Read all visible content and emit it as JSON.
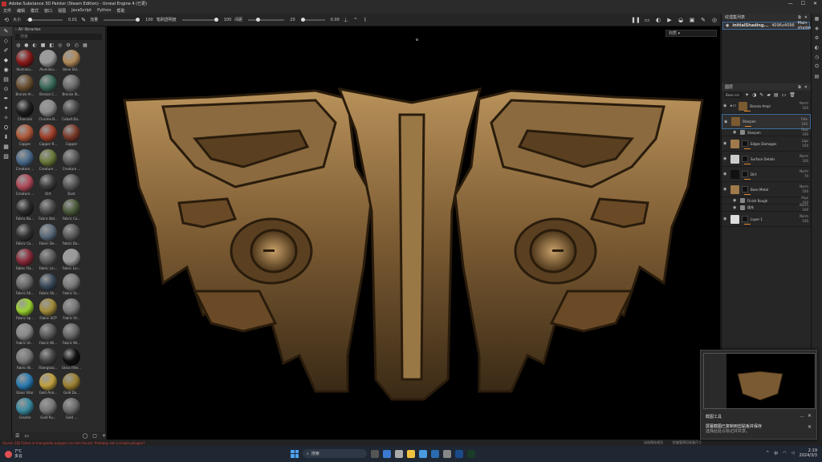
{
  "window": {
    "title": "Adobe Substance 3D Painter (Steam Edition) - Unreal Engine 4 (已更)",
    "controls": [
      "—",
      "☐",
      "✕"
    ]
  },
  "menu": [
    "文件",
    "编辑",
    "模式",
    "窗口",
    "视图",
    "JavaScript",
    "Python",
    "帮助"
  ],
  "toolbar": {
    "size_label": "大小",
    "size_value": "0.01",
    "flow_label": "流量",
    "flow_value": "100",
    "opacity_label": "笔刷透明度",
    "opacity_value": "100",
    "spacing_label": "间距",
    "spacing_value": "20",
    "extra_value": "0.00"
  },
  "shelf": {
    "header": "All libraries",
    "search_placeholder": "搜索",
    "materials": [
      {
        "name": "Aluminiu...",
        "color": "#8a1a1a"
      },
      {
        "name": "Aluminiu...",
        "color": "#9a9a9a"
      },
      {
        "name": "Bone Stil...",
        "color": "#b08a58"
      },
      {
        "name": "Bronze Ar...",
        "color": "#6a5030"
      },
      {
        "name": "Bronze C...",
        "color": "#3a6a5a"
      },
      {
        "name": "Bronze St...",
        "color": "#6a6a6a"
      },
      {
        "name": "Charcoal",
        "color": "#1e1e1e"
      },
      {
        "name": "Chrome B...",
        "color": "#8a8a8a"
      },
      {
        "name": "Cobalt Da...",
        "color": "#4a4a4a"
      },
      {
        "name": "Copper",
        "color": "#b05a3a"
      },
      {
        "name": "Copper R...",
        "color": "#a0402a"
      },
      {
        "name": "Copper",
        "color": "#7a3a2a"
      },
      {
        "name": "Creature ...",
        "color": "#4a6a8a"
      },
      {
        "name": "Creature ...",
        "color": "#6a7a3a"
      },
      {
        "name": "Creature ...",
        "color": "#5a5a5a"
      },
      {
        "name": "Creature ...",
        "color": "#b04a5a"
      },
      {
        "name": "Dirt",
        "color": "#3a3a3a"
      },
      {
        "name": "Dust",
        "color": "#555"
      },
      {
        "name": "Fabric Ba...",
        "color": "#2a2a2a"
      },
      {
        "name": "Fabric Bot...",
        "color": "#4a4a4a"
      },
      {
        "name": "Fabric Co...",
        "color": "#4a5a3a"
      },
      {
        "name": "Fabric Co...",
        "color": "#333"
      },
      {
        "name": "Fabric De...",
        "color": "#5a6a7a"
      },
      {
        "name": "Fabric Do...",
        "color": "#5a5a5a"
      },
      {
        "name": "Fabric Fla...",
        "color": "#8a2a3a"
      },
      {
        "name": "Fabric Lin...",
        "color": "#5a5a5a"
      },
      {
        "name": "Fabric Lin...",
        "color": "#9a9a9a"
      },
      {
        "name": "Fabric Sti...",
        "color": "#6a6a6a"
      },
      {
        "name": "Fabric Sh...",
        "color": "#3a4a5a"
      },
      {
        "name": "Fabric Sc...",
        "color": "#7a7a7a"
      },
      {
        "name": "Fabric Sp...",
        "color": "#9ad030"
      },
      {
        "name": "Fabric UCP",
        "color": "#a08a3a"
      },
      {
        "name": "Fabric Ut...",
        "color": "#777"
      },
      {
        "name": "Fabric Ut...",
        "color": "#888"
      },
      {
        "name": "Fabric Wi...",
        "color": "#5a5a5a"
      },
      {
        "name": "Fabric Wi...",
        "color": "#666"
      },
      {
        "name": "Fabric W...",
        "color": "#777"
      },
      {
        "name": "Fiberglass...",
        "color": "#444"
      },
      {
        "name": "Glass Filte...",
        "color": "#111"
      },
      {
        "name": "Glass Vitor",
        "color": "#2a7ab0"
      },
      {
        "name": "Gold Arm...",
        "color": "#c0a040"
      },
      {
        "name": "Gold Da...",
        "color": "#9a8030"
      },
      {
        "name": "Granite",
        "color": "#3a8aa0"
      },
      {
        "name": "Gold Ru...",
        "color": "#777"
      },
      {
        "name": "Gold ...",
        "color": "#6a6a6a"
      }
    ]
  },
  "viewport": {
    "mode_dropdown": "材质"
  },
  "right": {
    "texset_title": "纹理集列表",
    "texset_name": "initialShading...",
    "texset_res": "4096x4096",
    "texset_shader": "Main shader",
    "layers_title": "图层",
    "blend_dd": "Base col",
    "layers": [
      {
        "name": "Bronze Ampl",
        "blend": "Norm",
        "op": "100",
        "thumb": "#7a5a30",
        "type": "folder"
      },
      {
        "name": "Sharpen",
        "blend": "Filte",
        "op": "100",
        "thumb": "#7a5a30",
        "type": "sel"
      },
      {
        "name": "Sharpen",
        "blend": "Repl",
        "op": "100",
        "thumb": "#888",
        "type": "sub"
      },
      {
        "name": "Edges Damages",
        "blend": "Ligo",
        "op": "100",
        "thumb": "#a07a4a",
        "type": "normal"
      },
      {
        "name": "Surface Details",
        "blend": "Norm",
        "op": "100",
        "thumb": "#ccc",
        "type": "normal"
      },
      {
        "name": "Dirt",
        "blend": "Norm",
        "op": "70",
        "thumb": "#111",
        "type": "normal"
      },
      {
        "name": "Base Metal",
        "blend": "Norm",
        "op": "100",
        "thumb": "#a07a4a",
        "type": "normal"
      },
      {
        "name": "Finish Rough",
        "blend": "Repl",
        "op": "100",
        "thumb": "#888",
        "type": "sub"
      },
      {
        "name": "填充",
        "blend": "Norm",
        "op": "100",
        "thumb": "#888",
        "type": "sub"
      },
      {
        "name": "Layer 1",
        "blend": "Norm",
        "op": "100",
        "thumb": "#ddd",
        "type": "normal"
      }
    ]
  },
  "status": {
    "error": "[Scene 3D] Failed at triangulate polygon (no tem found). Probably not a simple polygon?",
    "r1": "自动保存成功",
    "r2": "检查暂停后标准尺寸"
  },
  "toast": {
    "title": "截图工具",
    "message_1": "屏幕截图已复制到剪贴板并保存",
    "message_2": "选择此处以标记并共享。",
    "close": "✕"
  },
  "taskbar": {
    "weather_temp": "7°C",
    "weather_desc": "多云",
    "search_placeholder": "搜索",
    "lang": "中",
    "time": "2:19",
    "date": "2024/3/3"
  }
}
